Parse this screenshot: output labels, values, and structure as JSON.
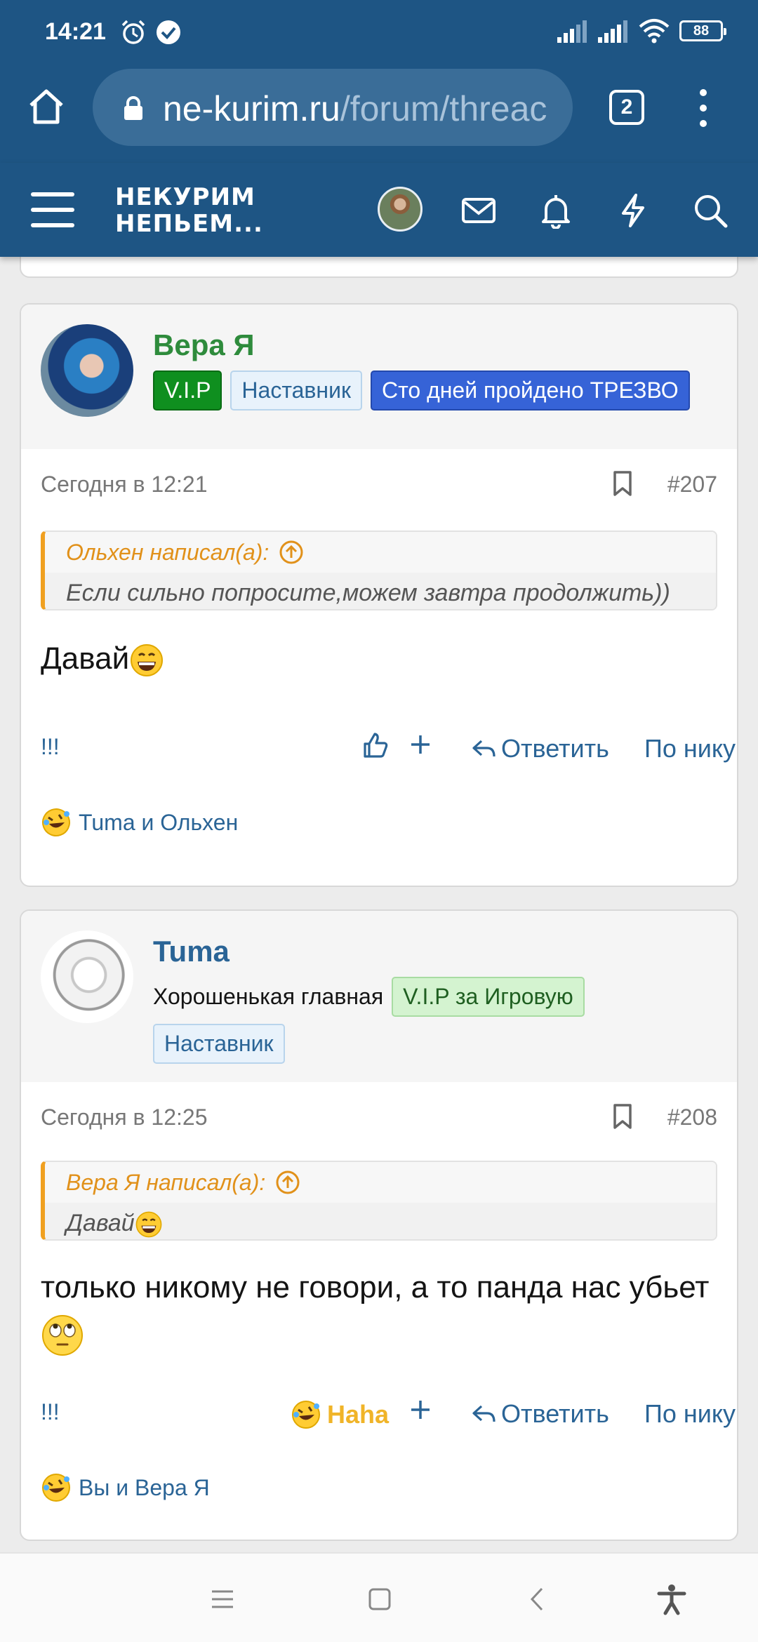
{
  "status_bar": {
    "time": "14:21",
    "battery": "88"
  },
  "browser": {
    "url_host": "ne-kurim.ru",
    "url_path": "/forum/threac",
    "tab_count": "2"
  },
  "forum_header": {
    "logo_line1": "НЕКУРИМ",
    "logo_line2": "НЕПЬЕМ..."
  },
  "posts": [
    {
      "username": "Вера Я",
      "username_color": "#2e8b3c",
      "badges": [
        "V.I.P",
        "Наставник",
        "Сто дней пройдено ТРЕЗВО"
      ],
      "date": "Сегодня в 12:21",
      "number": "#207",
      "quote_author": "Ольхен написал(а):",
      "quote_text": "Если сильно попросите,можем завтра продолжить))",
      "message": "Давай",
      "actions": {
        "bang": "!!!",
        "reply": "Ответить",
        "by_nick": "По нику"
      },
      "reactions_text": "Tuma и Ольхен"
    },
    {
      "username": "Tuma",
      "username_color": "#2a6496",
      "title": "Хорошенькая главная",
      "badges": [
        "V.I.P за Игровую",
        "Наставник"
      ],
      "date": "Сегодня в 12:25",
      "number": "#208",
      "quote_author": "Вера Я написал(а):",
      "quote_text": "Давай",
      "message": "только никому не говори, а то панда нас убьет",
      "actions": {
        "bang": "!!!",
        "reaction": "Haha",
        "reply": "Ответить",
        "by_nick": "По нику"
      },
      "reactions_text": "Вы и Вера Я"
    }
  ],
  "colors": {
    "header_bg": "#1e5584",
    "link": "#2a6496",
    "quote_accent": "#f0a020",
    "vip_badge": "#0f8f1f",
    "hundred_days_badge": "#3663d7"
  }
}
